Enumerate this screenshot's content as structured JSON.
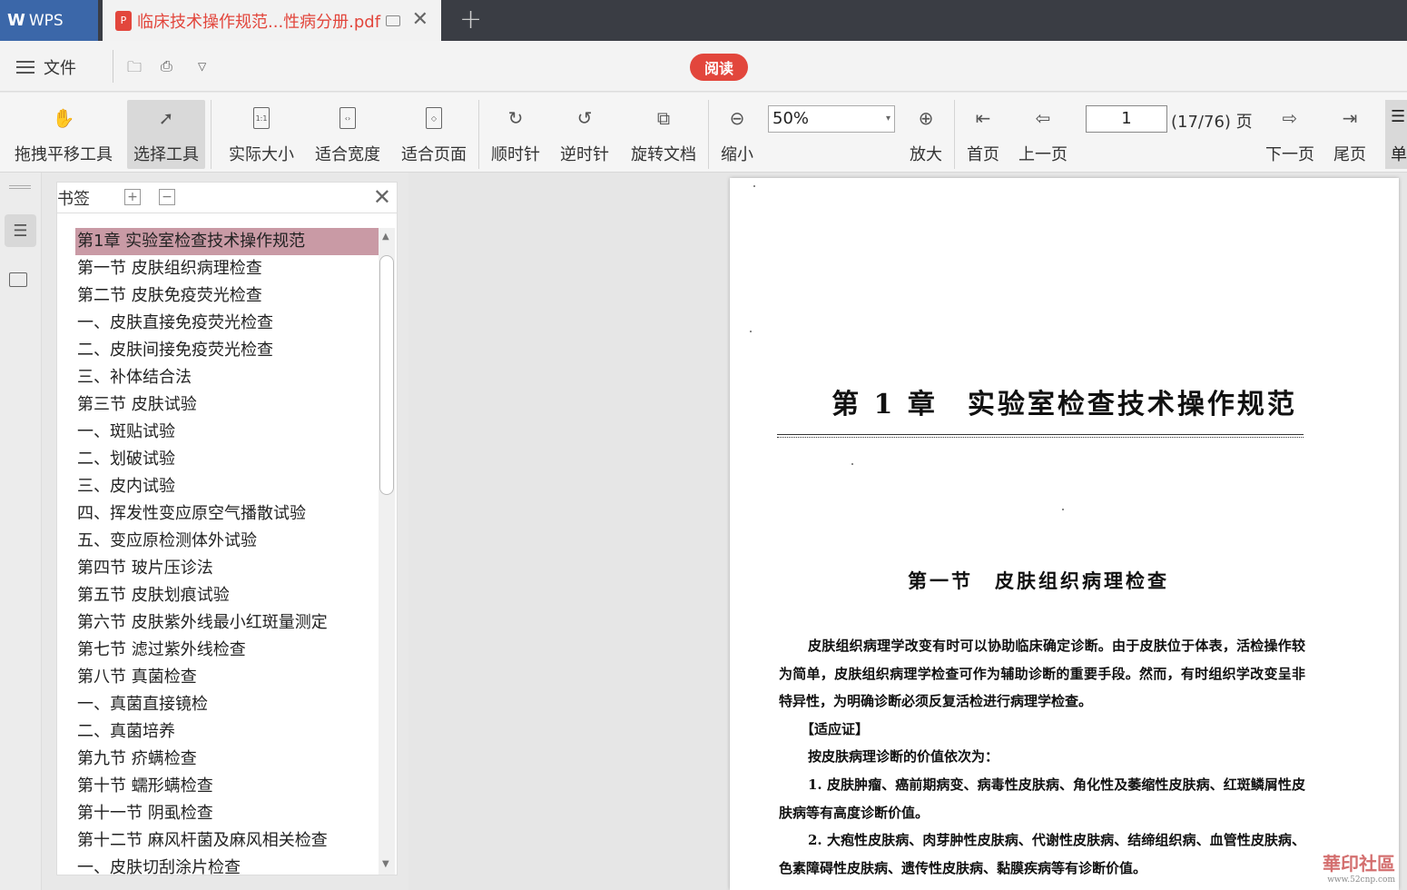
{
  "titlebar": {
    "app_name": "WPS",
    "doc_tab_title": "临床技术操作规范...性病分册.pdf"
  },
  "menubar": {
    "file_label": "文件",
    "read_label": "阅读"
  },
  "toolbar": {
    "pan_tool": "拖拽平移工具",
    "select_tool": "选择工具",
    "actual_size": "实际大小",
    "fit_width": "适合宽度",
    "fit_page": "适合页面",
    "clockwise": "顺时针",
    "counterclockwise": "逆时针",
    "rotate_doc": "旋转文档",
    "zoom_out": "缩小",
    "zoom_value": "50%",
    "zoom_in": "放大",
    "first_page": "首页",
    "prev_page": "上一页",
    "page_input": "1",
    "page_count": "(17/76) 页",
    "next_page": "下一页",
    "last_page": "尾页",
    "single": "单"
  },
  "bookmarks": {
    "title": "书签",
    "items": [
      "第1章 实验室检查技术操作规范",
      "第一节 皮肤组织病理检查",
      "第二节 皮肤免疫荧光检查",
      "一、皮肤直接免疫荧光检查",
      "二、皮肤间接免疫荧光检查",
      "三、补体结合法",
      "第三节 皮肤试验",
      "一、斑贴试验",
      "二、划破试验",
      "三、皮内试验",
      "四、挥发性变应原空气播散试验",
      "五、变应原检测体外试验",
      "第四节 玻片压诊法",
      "第五节 皮肤划痕试验",
      "第六节 皮肤紫外线最小红斑量测定",
      "第七节 滤过紫外线检查",
      "第八节 真菌检查",
      "一、真菌直接镜检",
      "二、真菌培养",
      "第九节 疥螨检查",
      "第十节 蠕形螨检查",
      "第十一节 阴虱检查",
      "第十二节 麻风杆菌及麻风相关检查",
      "一、皮肤切刮涂片检查"
    ]
  },
  "document": {
    "chapter_title": "第 1 章　实验室检查技术操作规范",
    "section_title": "第一节　皮肤组织病理检查",
    "paragraphs": [
      "皮肤组织病理学改变有时可以协助临床确定诊断。由于皮肤位于体表，活检操作较为简单，皮肤组织病理学检查可作为辅助诊断的重要手段。然而，有时组织学改变呈非特异性，为明确诊断必须反复活检进行病理学检查。",
      "【适应证】",
      "按皮肤病理诊断的价值依次为：",
      "1. 皮肤肿瘤、癌前期病变、病毒性皮肤病、角化性及萎缩性皮肤病、红斑鳞屑性皮肤病等有高度诊断价值。",
      "2. 大疱性皮肤病、肉芽肿性皮肤病、代谢性皮肤病、结缔组织病、血管性皮肤病、色素障碍性皮肤病、遗传性皮肤病、黏膜疾病等有诊断价值。"
    ],
    "watermark": "華印社區",
    "watermark_url": "www.52cnp.com"
  },
  "colors": {
    "accent_red": "#e2463c",
    "selected_bookmark": "#c99aa5",
    "wps_blue": "#3b67a9"
  }
}
